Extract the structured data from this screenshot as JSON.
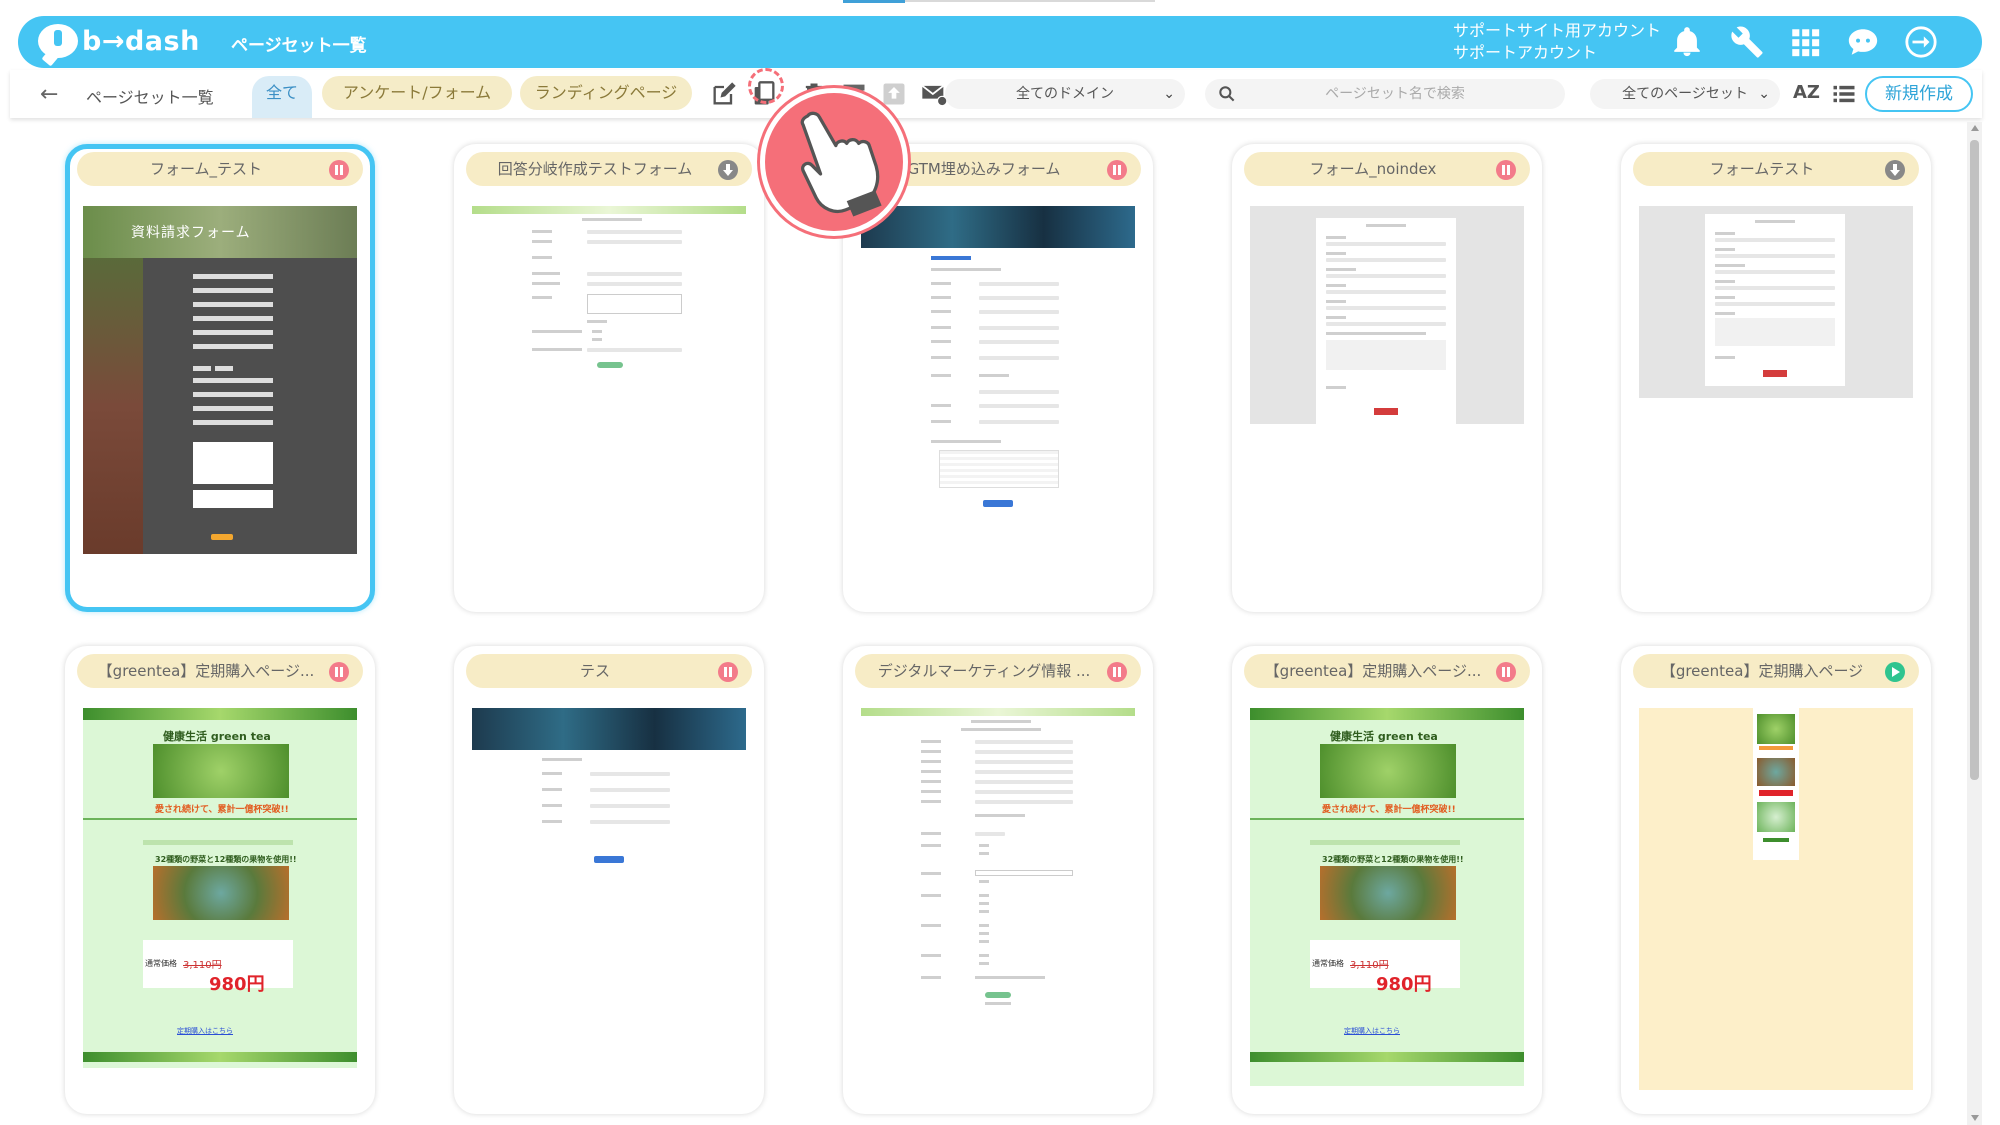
{
  "app": {
    "logo_text": "b→dash",
    "header_title": "ページセット一覧",
    "account_line1": "サポートサイト用アカウント",
    "account_line2": "サポートアカウント"
  },
  "toolbar": {
    "breadcrumb": "ページセット一覧",
    "tabs": [
      {
        "label": "全て",
        "active": true
      },
      {
        "label": "アンケート/フォーム",
        "active": false
      },
      {
        "label": "ランディングページ",
        "active": false
      }
    ],
    "domain_select": "全てのドメイン",
    "search_placeholder": "ページセット名で検索",
    "pageset_select": "全てのページセット",
    "sort_label": "AZ",
    "new_button": "新規作成"
  },
  "cards": [
    {
      "title": "フォーム_テスト",
      "status": "paused",
      "selected": true,
      "thumb": "dark-form"
    },
    {
      "title": "回答分岐作成テストフォーム",
      "status": "download",
      "thumb": "green-form"
    },
    {
      "title": "GTM埋め込みフォーム",
      "status": "paused",
      "thumb": "banner-form"
    },
    {
      "title": "フォーム_noindex",
      "status": "paused",
      "thumb": "grey-form"
    },
    {
      "title": "フォームテスト",
      "status": "download",
      "thumb": "grey-form-small"
    },
    {
      "title": "【greentea】定期購入ページ...",
      "status": "paused",
      "thumb": "greentea"
    },
    {
      "title": "テス",
      "status": "paused",
      "thumb": "banner-small"
    },
    {
      "title": "デジタルマーケティング情報 ...",
      "status": "paused",
      "thumb": "green-form-long"
    },
    {
      "title": "【greentea】定期購入ページ...",
      "status": "paused",
      "thumb": "greentea"
    },
    {
      "title": "【greentea】定期購入ページ",
      "status": "published",
      "thumb": "greentea-mini"
    }
  ],
  "thumb_text": {
    "dark_form_heading": "資料請求フォーム",
    "greentea_brand": "健康生活 green tea",
    "greentea_slogan": "愛され続けて、累計一億杯突破!!",
    "greentea_veg": "32種類の野菜と12種類の果物を使用!!",
    "greentea_regular": "通常価格",
    "greentea_old_price": "3,110円",
    "greentea_price": "980円",
    "greentea_link": "定期購入はこちら"
  },
  "colors": {
    "header": "#45c5f3",
    "tab": "#f5ecc8",
    "paused": "#f37b8a",
    "published": "#2fc48f",
    "pointer": "#f56f79"
  }
}
